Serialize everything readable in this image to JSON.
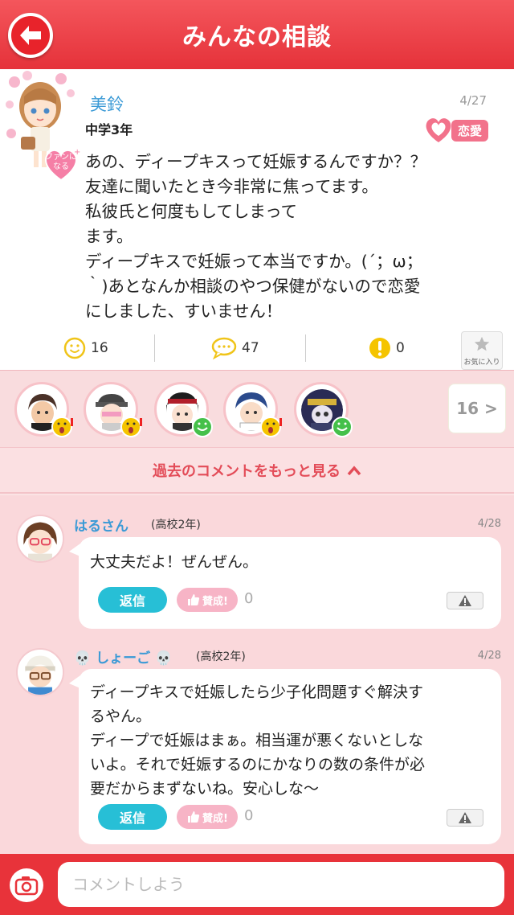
{
  "header": {
    "title": "みんなの相談"
  },
  "post": {
    "poster_name": "美鈴",
    "date": "4/27",
    "grade": "中学3年",
    "fan_badge": "ファンに なる",
    "category": "恋愛",
    "body": "あの、ディープキスって妊娠するんですか？？\n友達に聞いたとき今非常に焦ってます。\n私彼氏と何度もしてしまって\nます。\nディープキスで妊娠って本当ですか。(´；ω；\n｀)あとなんか相談のやつ保健がないので恋愛\nにしました、すいません！",
    "stats": {
      "smile": "16",
      "comments": "47",
      "alert": "0"
    },
    "favorite_label": "お気に入り"
  },
  "reactors": {
    "more_label": "16 >"
  },
  "more_comments_label": "過去のコメントをもっと見る",
  "comments": [
    {
      "name": "はるさん",
      "grade": "(高校2年)",
      "date": "4/28",
      "text": "大丈夫だよ！ぜんぜん。",
      "reply_label": "返信",
      "like_label": "賛成!",
      "like_count": "0"
    },
    {
      "name": "しょーご",
      "name_prefix": "💀",
      "name_suffix": "💀",
      "grade": "(高校2年)",
      "date": "4/28",
      "text": "ディープキスで妊娠したら少子化問題すぐ解決す\nるやん。\nディープで妊娠はまぁ。相当運が悪くないとしな\nいよ。それで妊娠するのにかなりの数の条件が必\n要だからまずないね。安心しな〜",
      "reply_label": "返信",
      "like_label": "賛成!",
      "like_count": "0"
    }
  ],
  "composer": {
    "placeholder": "コメントしよう"
  },
  "colors": {
    "header_red": "#e5323a",
    "accent_pink": "#f2728b",
    "reply_cyan": "#27bfd6",
    "name_blue": "#3b9ad6"
  }
}
